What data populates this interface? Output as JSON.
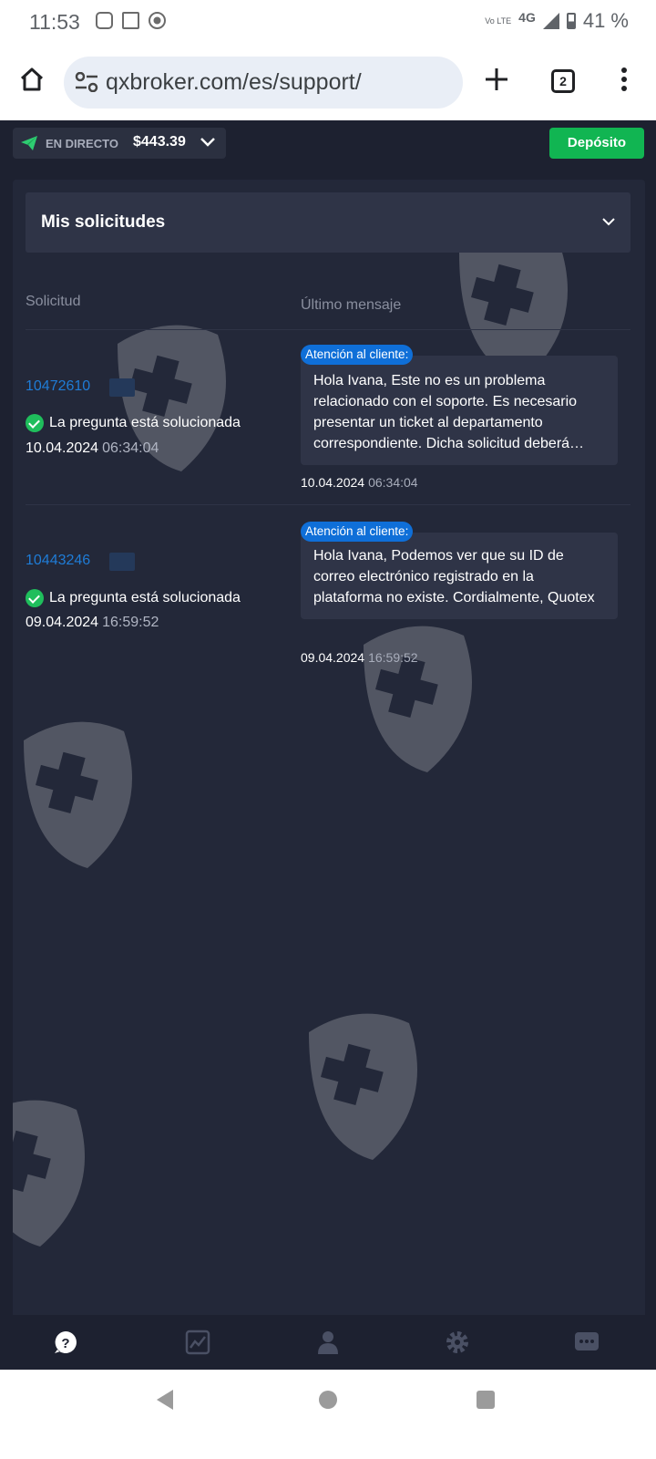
{
  "status_bar": {
    "time": "11:53",
    "notification_icons": [
      "instagram-icon",
      "calendar-icon",
      "soccer-ball-icon"
    ],
    "volte": "Vo LTE",
    "network": "4G",
    "battery": "41 %"
  },
  "browser": {
    "url": "qxbroker.com/es/support/",
    "tab_count": "2"
  },
  "header": {
    "live_label": "EN DIRECTO",
    "balance": "$443.39",
    "deposit_label": "Depósito",
    "accent_color": "#11b552"
  },
  "requests": {
    "section_title": "Mis solicitudes",
    "col_request": "Solicitud",
    "col_last_message": "Último mensaje",
    "items": [
      {
        "id": "10472610",
        "status": "La pregunta está solucionada",
        "date": "10.04.2024",
        "time": "06:34:04",
        "sender": "Atención al cliente:",
        "message": "Hola Ivana, Este no es un problema relacionado con el soporte. Es necesario presentar un ticket al departamento correspondiente. Dicha solicitud deberá…",
        "msg_date": "10.04.2024",
        "msg_time": "06:34:04"
      },
      {
        "id": "10443246",
        "status": "La pregunta está solucionada",
        "date": "09.04.2024",
        "time": "16:59:52",
        "sender": "Atención al cliente:",
        "message": "Hola Ivana, Podemos ver que su ID de correo electrónico registrado en la plataforma no existe. Cordialmente, Quotex",
        "msg_date": "09.04.2024",
        "msg_time": "16:59:52"
      }
    ]
  },
  "bottom_nav": [
    "help-icon",
    "chart-icon",
    "profile-icon",
    "settings-icon",
    "chat-icon"
  ]
}
